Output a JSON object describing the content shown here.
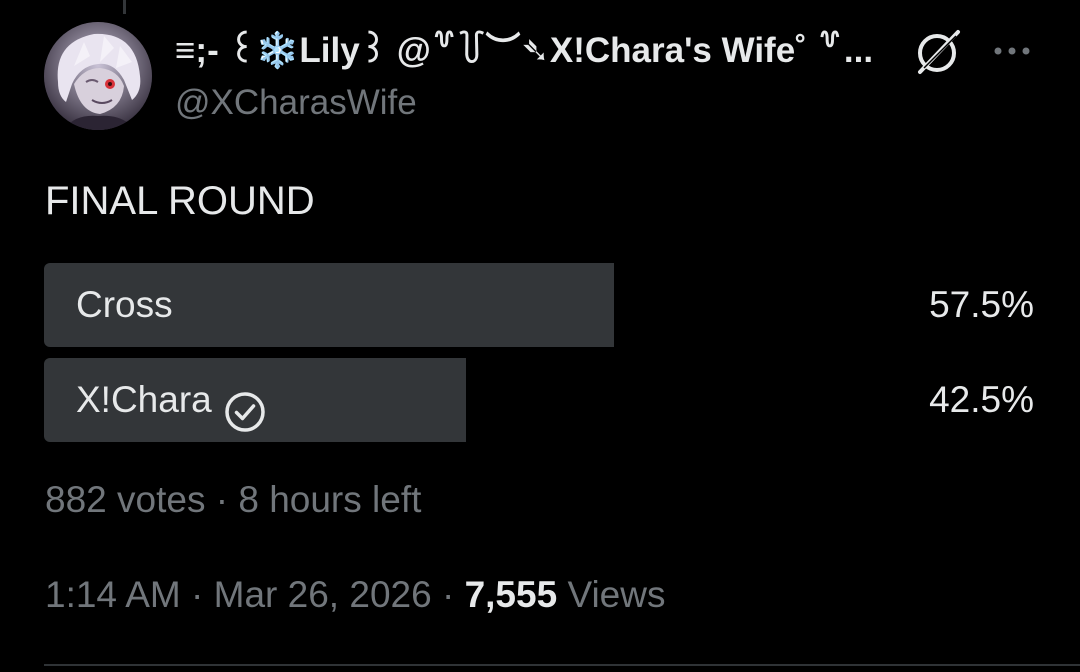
{
  "author": {
    "display_name": "≡;- ꒰❄️Lily꒱ @꒷꒦︶➴X!Chara's Wife˚ ꒷...",
    "handle": "@XCharasWife"
  },
  "post": {
    "text": "FINAL ROUND"
  },
  "poll": {
    "options": [
      {
        "label": "Cross",
        "percent_text": "57.5%",
        "percent": 57.5,
        "verified_check": false
      },
      {
        "label": "X!Chara",
        "percent_text": "42.5%",
        "percent": 42.5,
        "verified_check": true
      }
    ],
    "votes": "882 votes",
    "separator": "·",
    "time_left": "8 hours left"
  },
  "meta": {
    "time": "1:14 AM",
    "date": "Mar 26, 2026",
    "separator": "·",
    "views_count": "7,555",
    "views_label": "Views"
  },
  "icons": {
    "grok": "grok-icon",
    "more": "more-icon",
    "check": "check-circle-icon"
  },
  "colors": {
    "background": "#000000",
    "text_primary": "#e7e9ea",
    "text_secondary": "#71767b",
    "poll_fill": "#333639",
    "divider": "#2f3336"
  }
}
